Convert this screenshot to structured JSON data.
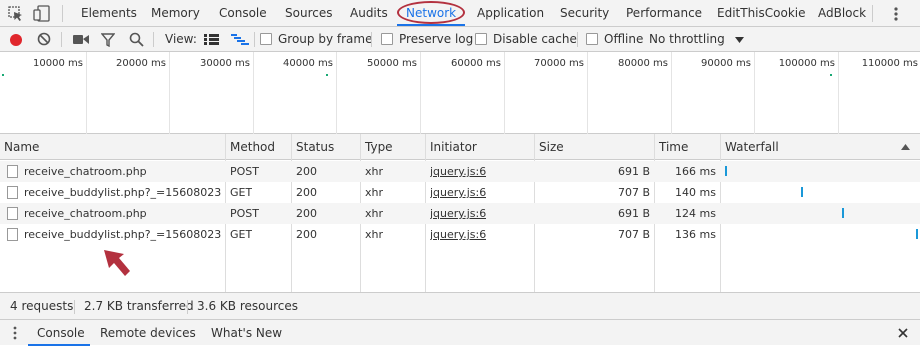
{
  "tabs": [
    "Elements",
    "Memory",
    "Console",
    "Sources",
    "Audits",
    "Network",
    "Application",
    "Security",
    "Performance",
    "EditThisCookie",
    "AdBlock"
  ],
  "toolbar": {
    "view_label": "View:",
    "group_by_frame": "Group by frame",
    "preserve_log": "Preserve log",
    "disable_cache": "Disable cache",
    "offline": "Offline",
    "throttling": "No throttling"
  },
  "overview": {
    "ticks": [
      "10000 ms",
      "20000 ms",
      "30000 ms",
      "40000 ms",
      "50000 ms",
      "60000 ms",
      "70000 ms",
      "80000 ms",
      "90000 ms",
      "100000 ms",
      "110000 ms"
    ]
  },
  "table": {
    "headers": [
      "Name",
      "Method",
      "Status",
      "Type",
      "Initiator",
      "Size",
      "Time",
      "Waterfall"
    ],
    "rows": [
      {
        "name": "receive_chatroom.php",
        "method": "POST",
        "status": "200",
        "type": "xhr",
        "initiator": "jquery.js:6",
        "size": "691 B",
        "time": "166 ms"
      },
      {
        "name": "receive_buddylist.php?_=15608023...",
        "method": "GET",
        "status": "200",
        "type": "xhr",
        "initiator": "jquery.js:6",
        "size": "707 B",
        "time": "140 ms"
      },
      {
        "name": "receive_chatroom.php",
        "method": "POST",
        "status": "200",
        "type": "xhr",
        "initiator": "jquery.js:6",
        "size": "691 B",
        "time": "124 ms"
      },
      {
        "name": "receive_buddylist.php?_=15608023...",
        "method": "GET",
        "status": "200",
        "type": "xhr",
        "initiator": "jquery.js:6",
        "size": "707 B",
        "time": "136 ms"
      }
    ]
  },
  "status": {
    "requests": "4 requests",
    "transferred": "2.7 KB transferred",
    "resources": "3.6 KB resources"
  },
  "drawer": {
    "tabs": [
      "Console",
      "Remote devices",
      "What's New"
    ]
  },
  "colors": {
    "accent": "#1a73e8",
    "record_red": "#e0262c",
    "annotation_red": "#b3313f",
    "waterfall_blue": "#1a98d8"
  }
}
